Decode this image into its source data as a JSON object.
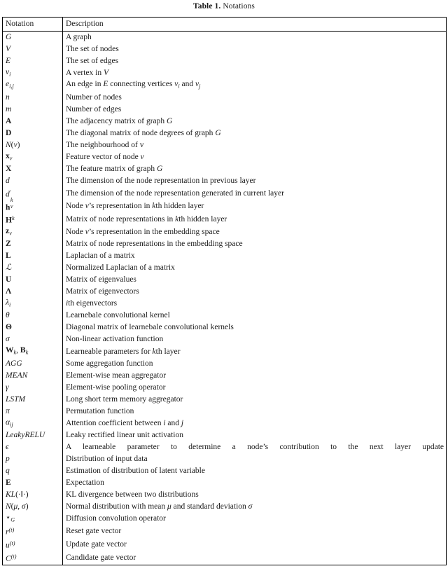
{
  "caption": {
    "label": "Table 1.",
    "text": "Notations"
  },
  "table": {
    "columns": [
      "Notation",
      "Description"
    ],
    "rows": [
      {
        "notation": "G",
        "description": "A graph"
      },
      {
        "notation": "V",
        "description": "The set of nodes"
      },
      {
        "notation": "E",
        "description": "The set of edges"
      },
      {
        "notation": "v_i",
        "description": "A vertex in V"
      },
      {
        "notation": "e_{i,j}",
        "description": "An edge in E connecting vertices v_i and v_j"
      },
      {
        "notation": "n",
        "description": "Number of nodes"
      },
      {
        "notation": "m",
        "description": "Number of edges"
      },
      {
        "notation": "A",
        "description": "The adjacency matrix of graph G"
      },
      {
        "notation": "D",
        "description": "The diagonal matrix of node degrees of graph G"
      },
      {
        "notation": "N(v)",
        "description": "The neighbourhood of v"
      },
      {
        "notation": "x_v",
        "description": "Feature vector of node v"
      },
      {
        "notation": "X",
        "description": "The feature matrix of graph G"
      },
      {
        "notation": "d",
        "description": "The dimension of the node representation in previous layer"
      },
      {
        "notation": "d'",
        "description": "The dimension of the node representation generated in current layer"
      },
      {
        "notation": "h_v^k",
        "description": "Node v's representation in kth hidden layer"
      },
      {
        "notation": "H^k",
        "description": "Matrix of node representations in kth hidden layer"
      },
      {
        "notation": "z_v",
        "description": "Node v's representation in the embedding space"
      },
      {
        "notation": "Z",
        "description": "Matrix of node representations in the embedding space"
      },
      {
        "notation": "L",
        "description": "Laplacian of a matrix"
      },
      {
        "notation": "ℒ",
        "description": "Normalized Laplacian of a matrix"
      },
      {
        "notation": "U",
        "description": "Matrix of eigenvalues"
      },
      {
        "notation": "Λ",
        "description": "Matrix of eigenvectors"
      },
      {
        "notation": "λ_i",
        "description": "ith eigenvectors"
      },
      {
        "notation": "θ",
        "description": "Learnebale convolutional kernel"
      },
      {
        "notation": "Θ",
        "description": "Diagonal matrix of learnebale convolutional kernels"
      },
      {
        "notation": "σ",
        "description": "Non-linear activation function"
      },
      {
        "notation": "W_k, B_k",
        "description": "Learneable parameters for kth layer"
      },
      {
        "notation": "AGG",
        "description": "Some aggregation function"
      },
      {
        "notation": "MEAN",
        "description": "Element-wise mean aggregator"
      },
      {
        "notation": "γ",
        "description": "Element-wise pooling operator"
      },
      {
        "notation": "LSTM",
        "description": "Long short term memory aggregator"
      },
      {
        "notation": "π",
        "description": "Permutation function"
      },
      {
        "notation": "α_ij",
        "description": "Attention coefficient between i and j"
      },
      {
        "notation": "LeakyRELU",
        "description": "Leaky rectified linear unit activation"
      },
      {
        "notation": "ϵ",
        "description": "A learneable parameter to determine a node's contribution to the next layer update"
      },
      {
        "notation": "p",
        "description": "Distribution of input data"
      },
      {
        "notation": "q",
        "description": "Estimation of distribution of latent variable"
      },
      {
        "notation": "𝔼",
        "description": "Expectation"
      },
      {
        "notation": "KL(·||·)",
        "description": "KL divergence between two distributions"
      },
      {
        "notation": "𝒩(μ, σ)",
        "description": "Normal distribution with mean μ and standard deviation σ"
      },
      {
        "notation": "⋆_G",
        "description": "Diffusion convolution operator"
      },
      {
        "notation": "r^(t)",
        "description": "Reset gate vector"
      },
      {
        "notation": "u^(t)",
        "description": "Update gate vector"
      },
      {
        "notation": "C^(t)",
        "description": "Candidate gate vector"
      }
    ]
  }
}
